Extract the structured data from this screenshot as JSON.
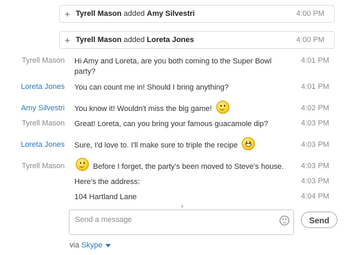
{
  "events": [
    {
      "actor": "Tyrell Mason",
      "verb": "added",
      "target": "Amy Silvestri",
      "time": "4:00 PM"
    },
    {
      "actor": "Tyrell Mason",
      "verb": "added",
      "target": "Loreta Jones",
      "time": "4:00 PM"
    }
  ],
  "messages": [
    {
      "sender": "Tyrell Mason",
      "text": "Hi Amy and Loreta, are you both coming to the Super Bowl party?",
      "time": "4:01 PM"
    },
    {
      "sender": "Loreta Jones",
      "text": "You can count me in! Should I bring anything?",
      "time": "4:01 PM"
    },
    {
      "sender": "Amy Silvestri",
      "text": "You know it! Wouldn't miss the big game!",
      "time": "4:02 PM",
      "emoji": "smile"
    },
    {
      "sender": "Tyrell Mason",
      "text": "Great! Loreta, can you bring your famous guacamole dip?",
      "time": "4:03 PM"
    },
    {
      "sender": "Loreta Jones",
      "text": "Sure, I'd love to. I'll make sure to triple the recipe",
      "time": "4:03 PM",
      "emoji": "grin"
    },
    {
      "sender": "Tyrell Mason",
      "text": "Before I forget, the party's been moved to Steve's house.",
      "time": "4:03 PM",
      "emoji": "smile"
    },
    {
      "sender": "",
      "text": "Here's the address:",
      "time": "4:03 PM"
    },
    {
      "sender": "",
      "text": "104 Hartland Lane",
      "time": "4:04 PM"
    }
  ],
  "composer": {
    "placeholder": "Send a message",
    "emoji_icon": "smiley-icon",
    "send_label": "Send"
  },
  "footer": {
    "via_label": "via",
    "network_label": "Skype"
  },
  "colors": {
    "sender_gray": "#8a8a8a",
    "sender_blue": "#2a7ab9",
    "link_blue": "#2a7ab9"
  }
}
